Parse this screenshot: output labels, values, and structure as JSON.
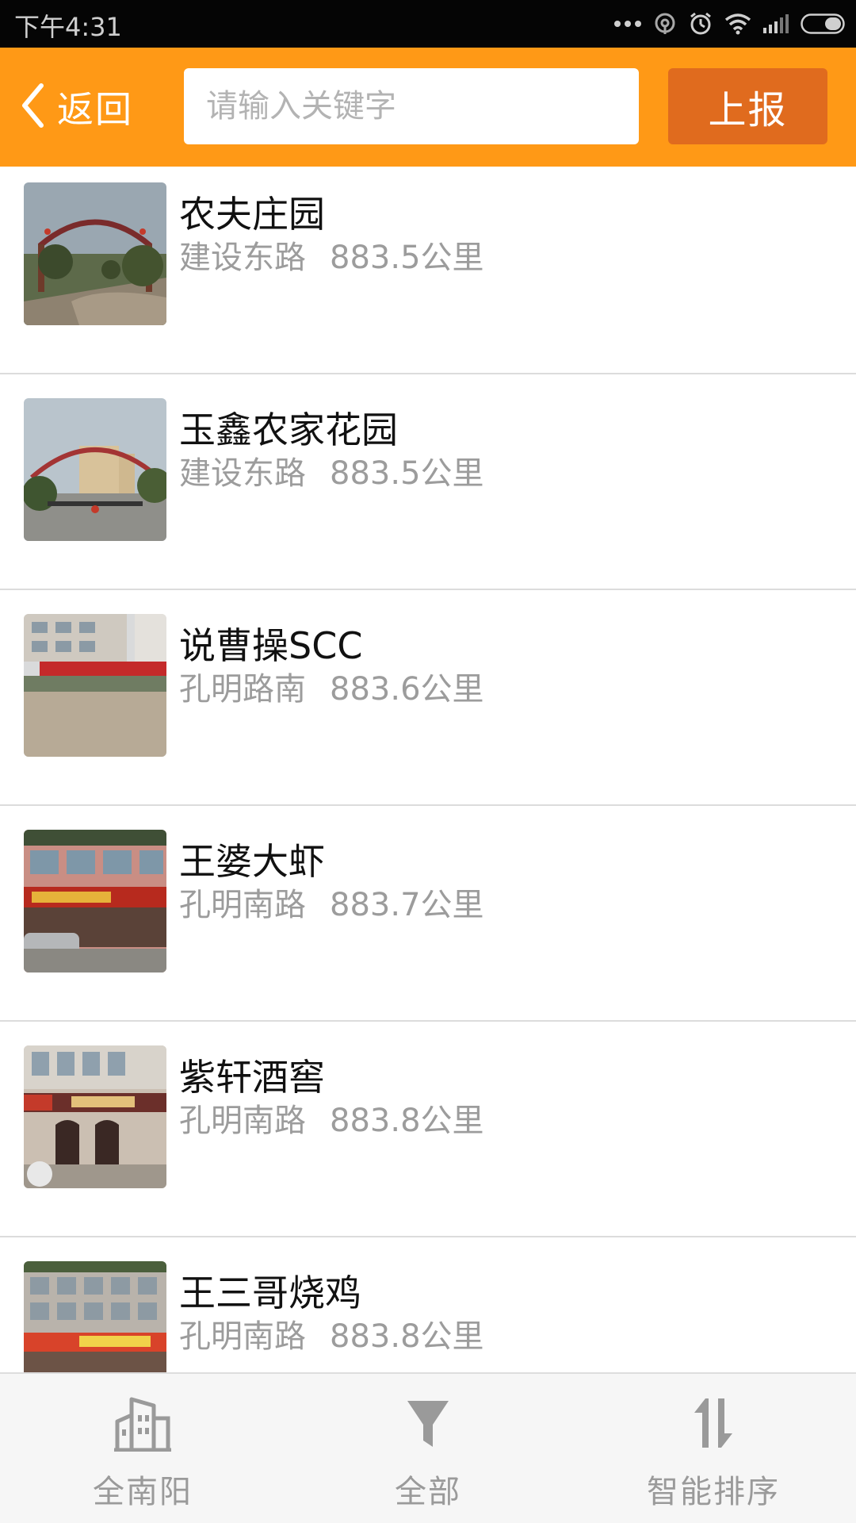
{
  "status_bar": {
    "time": "下午4:31",
    "icons": [
      "more-dots-icon",
      "signal-ring-icon",
      "alarm-icon",
      "wifi-icon",
      "cell-signal-icon",
      "battery-icon"
    ]
  },
  "header": {
    "back_label": "返回",
    "search_placeholder": "请输入关键字",
    "search_value": "",
    "report_label": "上报",
    "colors": {
      "bar": "#ff9916",
      "report_button": "#e06b1e"
    }
  },
  "places": [
    {
      "name": "农夫庄园",
      "street": "建设东路",
      "distance": "883.5公里"
    },
    {
      "name": "玉鑫农家花园",
      "street": "建设东路",
      "distance": "883.5公里"
    },
    {
      "name": "说曹操SCC",
      "street": "孔明路南",
      "distance": "883.6公里"
    },
    {
      "name": "王婆大虾",
      "street": "孔明南路",
      "distance": "883.7公里"
    },
    {
      "name": "紫轩酒窖",
      "street": "孔明南路",
      "distance": "883.8公里"
    },
    {
      "name": "王三哥烧鸡",
      "street": "孔明南路",
      "distance": "883.8公里"
    }
  ],
  "bottom_tabs": [
    {
      "label": "全南阳",
      "icon": "city-buildings-icon"
    },
    {
      "label": "全部",
      "icon": "filter-funnel-icon"
    },
    {
      "label": "智能排序",
      "icon": "sort-arrows-icon"
    }
  ]
}
